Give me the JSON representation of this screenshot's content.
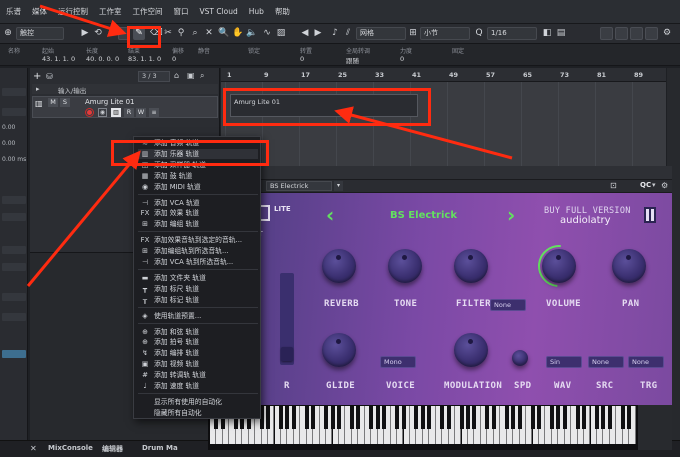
{
  "menu": [
    "乐谱",
    "媒体",
    "运行控制",
    "工作室",
    "工作空间",
    "窗口",
    "VST Cloud",
    "Hub",
    "帮助"
  ],
  "toolbar": {
    "mode": "触控",
    "snap_type": "网格",
    "grid": "小节",
    "quantize": "1/16"
  },
  "infoline": {
    "headers": [
      "名称",
      "起始",
      "长度",
      "结束",
      "偏移",
      "静音",
      "锁定",
      "转置",
      "全局转调",
      "力度",
      "固定"
    ],
    "values": [
      "",
      "43. 1. 1. 0",
      "40. 0. 0. 0",
      "83. 1. 1. 0",
      "0",
      "",
      "",
      "0",
      "跟随",
      "0",
      ""
    ]
  },
  "tracklist": {
    "counter": "3 / 3",
    "io_label": "输入/输出",
    "track_name": "Amurg Lite 01",
    "m": "M",
    "s": "S",
    "r": "R",
    "w": "W"
  },
  "ruler": [
    "1",
    "9",
    "17",
    "25",
    "33",
    "41",
    "49",
    "57",
    "65",
    "73",
    "81",
    "89"
  ],
  "event": {
    "label": "Amurg Lite 01"
  },
  "inspector": {
    "vals": [
      "0.00",
      "0.00",
      "0.00 ms"
    ]
  },
  "context_menu": {
    "items": [
      {
        "icon": "audio-track-icon",
        "glyph": "≋",
        "label": "添加 音频 轨道"
      },
      {
        "icon": "instrument-track-icon",
        "glyph": "▥",
        "label": "添加 乐器 轨道"
      },
      {
        "icon": "sampler-track-icon",
        "glyph": "◫",
        "label": "添加 采样器 轨道"
      },
      {
        "icon": "drum-track-icon",
        "glyph": "▦",
        "label": "添加 鼓 轨道"
      },
      {
        "icon": "midi-track-icon",
        "glyph": "◉",
        "label": "添加 MIDI 轨道"
      },
      {
        "sep": true
      },
      {
        "icon": "vca-track-icon",
        "glyph": "⊣",
        "label": "添加 VCA 轨道"
      },
      {
        "icon": "fx-track-icon",
        "glyph": "FX",
        "label": "添加 效果 轨道"
      },
      {
        "icon": "group-track-icon",
        "glyph": "⊞",
        "label": "添加 编组 轨道"
      },
      {
        "sep": true
      },
      {
        "icon": "fx-selected-icon",
        "glyph": "FX",
        "label": "添加效果音轨到选定的音轨..."
      },
      {
        "icon": "group-selected-icon",
        "glyph": "⊞",
        "label": "添加编组轨到所选音轨..."
      },
      {
        "icon": "vca-selected-icon",
        "glyph": "⊣",
        "label": "添加 VCA 轨到所选音轨..."
      },
      {
        "sep": true
      },
      {
        "icon": "folder-track-icon",
        "glyph": "▬",
        "label": "添加 文件夹 轨道"
      },
      {
        "icon": "ruler-track-icon",
        "glyph": "┳",
        "label": "添加 标尺 轨道"
      },
      {
        "icon": "marker-track-icon",
        "glyph": "┰",
        "label": "添加 标记 轨道"
      },
      {
        "sep": true
      },
      {
        "icon": "track-preset-icon",
        "glyph": "◈",
        "label": "使用轨道预置..."
      },
      {
        "sep": true
      },
      {
        "icon": "chord-track-icon",
        "glyph": "⊕",
        "label": "添加 和弦 轨道"
      },
      {
        "icon": "signature-track-icon",
        "glyph": "⊕",
        "label": "添加 拍号 轨道"
      },
      {
        "icon": "arranger-track-icon",
        "glyph": "↯",
        "label": "添加 编排 轨道"
      },
      {
        "icon": "video-track-icon",
        "glyph": "▣",
        "label": "添加 视频 轨道"
      },
      {
        "icon": "transpose-track-icon",
        "glyph": "#",
        "label": "添加 转调轨 轨道"
      },
      {
        "icon": "tempo-track-icon",
        "glyph": "♩",
        "label": "添加 速度 轨道"
      },
      {
        "sep": true
      },
      {
        "icon": "",
        "glyph": "",
        "label": "显示所有使用的自动化"
      },
      {
        "icon": "",
        "glyph": "",
        "label": "隐藏所有自动化"
      }
    ]
  },
  "plugin": {
    "instrument": "BS Electrick",
    "qc": "QC",
    "lite": "LITE",
    "buy": "BUY FULL VERSION",
    "brand": "audiolatry",
    "knobs1": [
      "REVERB",
      "TONE",
      "FILTER",
      "VOLUME",
      "PAN"
    ],
    "knobs2": [
      "R",
      "GLIDE",
      "VOICE",
      "MODULATION",
      "SPD",
      "WAV",
      "SRC",
      "TRG"
    ],
    "filter_field": "None",
    "voice_field": "Mono",
    "wav_field": "Sin",
    "src_field": "None",
    "trg_field": "None"
  },
  "statusbar": {
    "mixconsole": "MixConsole",
    "editor": "编辑器",
    "drum": "Drum Ma"
  },
  "colors": {
    "highlight": "#ff2b10",
    "synth_green": "#63e25f"
  }
}
